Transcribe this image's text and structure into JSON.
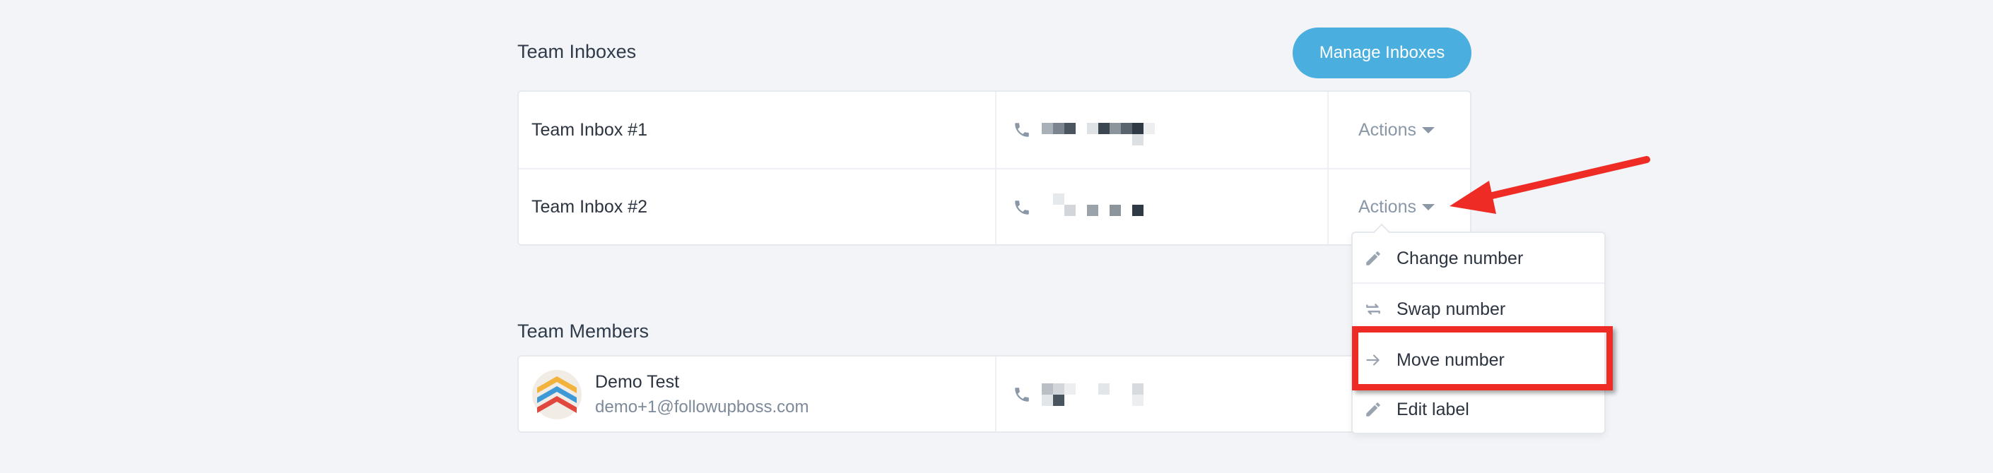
{
  "team_inboxes": {
    "title": "Team Inboxes",
    "manage_button": "Manage Inboxes",
    "rows": [
      {
        "name": "Team Inbox #1",
        "actions_label": "Actions"
      },
      {
        "name": "Team Inbox #2",
        "actions_label": "Actions"
      }
    ]
  },
  "team_members": {
    "title": "Team Members",
    "rows": [
      {
        "name": "Demo Test",
        "email": "demo+1@followupboss.com"
      }
    ]
  },
  "actions_menu": {
    "items": [
      {
        "label": "Change number",
        "icon": "pencil-icon"
      },
      {
        "label": "Swap number",
        "icon": "swap-icon"
      },
      {
        "label": "Move number",
        "icon": "arrow-right-icon"
      },
      {
        "label": "Edit label",
        "icon": "pencil-icon"
      }
    ]
  },
  "annotation": {
    "highlight_color": "#ee2b24",
    "highlighted_item": "Move number"
  },
  "colors": {
    "accent": "#4aaede",
    "background": "#f2f4f7",
    "muted_text": "#8a97a7"
  }
}
